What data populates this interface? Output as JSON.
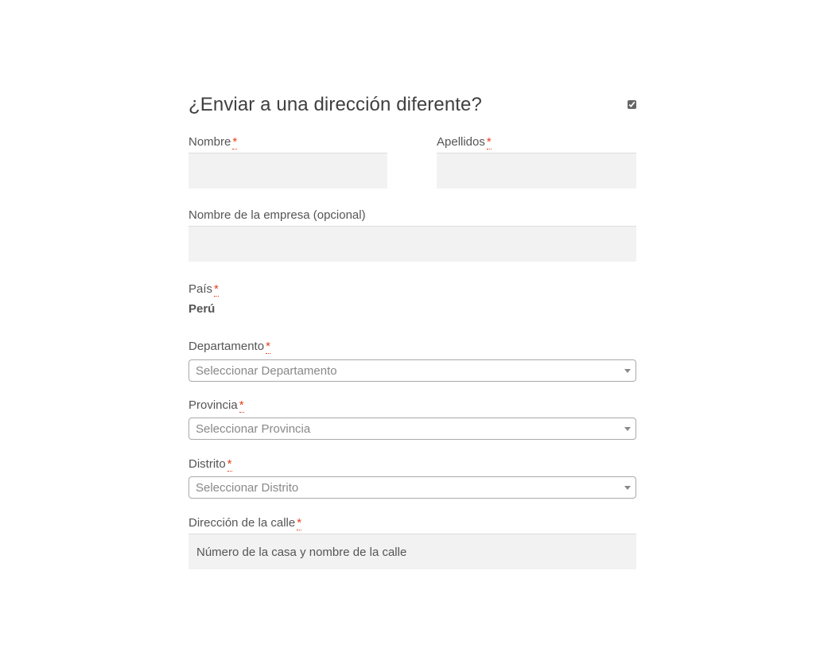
{
  "shipping": {
    "heading": "¿Enviar a una dirección diferente?",
    "ship_to_different": true,
    "required_mark": "*",
    "first_name": {
      "label": "Nombre",
      "value": "",
      "placeholder": ""
    },
    "last_name": {
      "label": "Apellidos",
      "value": "",
      "placeholder": ""
    },
    "company": {
      "label": "Nombre de la empresa (opcional)",
      "value": "",
      "placeholder": ""
    },
    "country": {
      "label": "País",
      "value": "Perú"
    },
    "department": {
      "label": "Departamento",
      "selected": "Seleccionar Departamento"
    },
    "province": {
      "label": "Provincia",
      "selected": "Seleccionar Provincia"
    },
    "district": {
      "label": "Distrito",
      "selected": "Seleccionar Distrito"
    },
    "street": {
      "label": "Dirección de la calle",
      "value": "",
      "placeholder": "Número de la casa y nombre de la calle"
    }
  },
  "colors": {
    "required": "#e2401c",
    "input_bg": "#f2f2f2",
    "text": "#555555"
  },
  "icons": {
    "select_arrow": "chevron-down-icon"
  }
}
